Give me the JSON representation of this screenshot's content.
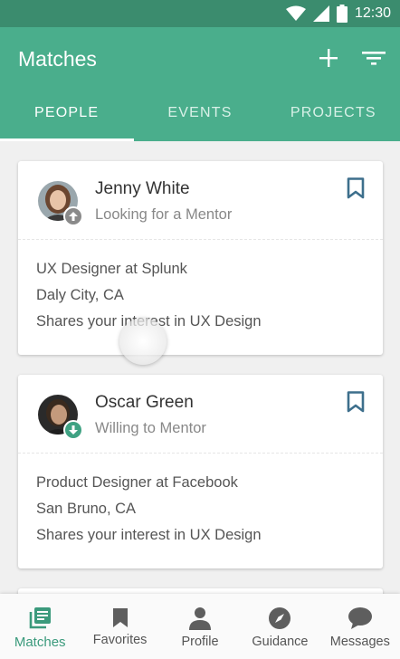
{
  "status_bar": {
    "time": "12:30",
    "icons": [
      "wifi-icon",
      "signal-icon",
      "battery-icon"
    ]
  },
  "app_bar": {
    "title": "Matches",
    "actions": [
      "add-icon",
      "filter-icon"
    ]
  },
  "tabs": [
    {
      "label": "PEOPLE",
      "active": true
    },
    {
      "label": "EVENTS",
      "active": false
    },
    {
      "label": "PROJECTS",
      "active": false
    }
  ],
  "matches": [
    {
      "name": "Jenny White",
      "status": "Looking for a Mentor",
      "status_icon": "arrow-up-icon",
      "badge_color": "#8a8a8a",
      "details": [
        "UX Designer at Splunk",
        "Daly City, CA",
        "Shares your interest in UX Design"
      ]
    },
    {
      "name": "Oscar Green",
      "status": "Willing to Mentor",
      "status_icon": "arrow-down-icon",
      "badge_color": "#3fa283",
      "details": [
        "Product Designer at Facebook",
        "San Bruno, CA",
        "Shares your interest in UX Design"
      ]
    }
  ],
  "bottom_nav": [
    {
      "label": "Matches",
      "icon": "matches-icon",
      "active": true
    },
    {
      "label": "Favorites",
      "icon": "bookmark-icon",
      "active": false
    },
    {
      "label": "Profile",
      "icon": "person-icon",
      "active": false
    },
    {
      "label": "Guidance",
      "icon": "compass-icon",
      "active": false
    },
    {
      "label": "Messages",
      "icon": "chat-icon",
      "active": false
    }
  ],
  "colors": {
    "primary": "#4aae8c",
    "primary_dark": "#3b8c6e",
    "bookmark": "#3d6f8c",
    "active_nav": "#3b9a7c"
  }
}
